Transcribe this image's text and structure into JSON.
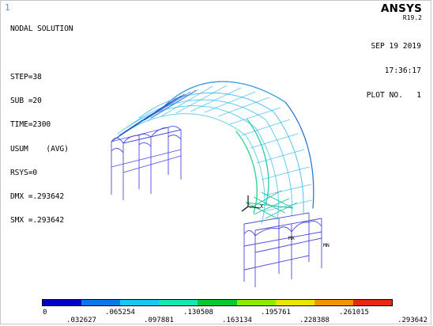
{
  "window": {
    "number": "1"
  },
  "header": {
    "lines": [
      "NODAL SOLUTION",
      "",
      "STEP=38",
      "SUB =20",
      "TIME=2300",
      "USUM    (AVG)",
      "RSYS=0",
      "DMX =.293642",
      "SMX =.293642"
    ]
  },
  "brand": {
    "name": "ANSYS",
    "release": "R19.2"
  },
  "stamp": {
    "date": "SEP 19 2019",
    "time": "17:36:17",
    "plot": "PLOT NO.   1"
  },
  "markers": {
    "min": "MN",
    "max": "MX",
    "axis": "X"
  },
  "legend": {
    "colors": [
      "#0000c8",
      "#0a78e6",
      "#19c8f0",
      "#14e6b4",
      "#0ac832",
      "#8ceb00",
      "#ebe600",
      "#f09600",
      "#e62814"
    ],
    "top_labels": [
      "0",
      ".065254",
      ".130508",
      ".195761",
      ".261015"
    ],
    "bottom_labels": [
      ".032627",
      ".097881",
      ".163134",
      ".228388",
      ".293642"
    ]
  }
}
